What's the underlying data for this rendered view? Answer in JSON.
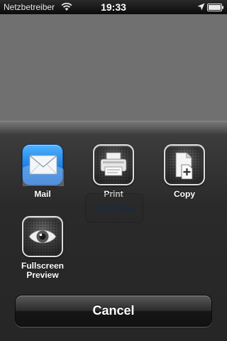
{
  "status_bar": {
    "carrier": "Netzbetreiber",
    "time": "19:33",
    "icons": [
      "wifi-icon",
      "location-arrow-icon",
      "battery-icon"
    ]
  },
  "background": {
    "preview_label": "Preview"
  },
  "action_sheet": {
    "actions": [
      {
        "label": "Mail",
        "icon": "mail-envelope-icon"
      },
      {
        "label": "Print",
        "icon": "printer-icon"
      },
      {
        "label": "Copy",
        "icon": "copy-document-icon"
      },
      {
        "label": "Fullscreen\nPreview",
        "icon": "eye-icon"
      }
    ],
    "cancel_label": "Cancel"
  }
}
